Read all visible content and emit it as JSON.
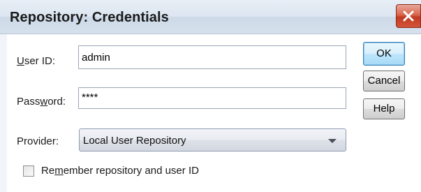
{
  "window": {
    "title": "Repository: Credentials"
  },
  "form": {
    "user_id_label": "User ID:",
    "user_id_value": "admin",
    "password_label": "Password:",
    "password_value": "****",
    "provider_label": "Provider:",
    "provider_value": "Local User Repository",
    "remember_label": "Remember repository and user ID",
    "remember_checked": false
  },
  "buttons": {
    "ok": "OK",
    "cancel": "Cancel",
    "help": "Help"
  },
  "icons": {
    "close": "close-icon",
    "dropdown": "chevron-down-icon"
  },
  "colors": {
    "close_button": "#c84a2f",
    "title_bar": "#dde6f1"
  }
}
